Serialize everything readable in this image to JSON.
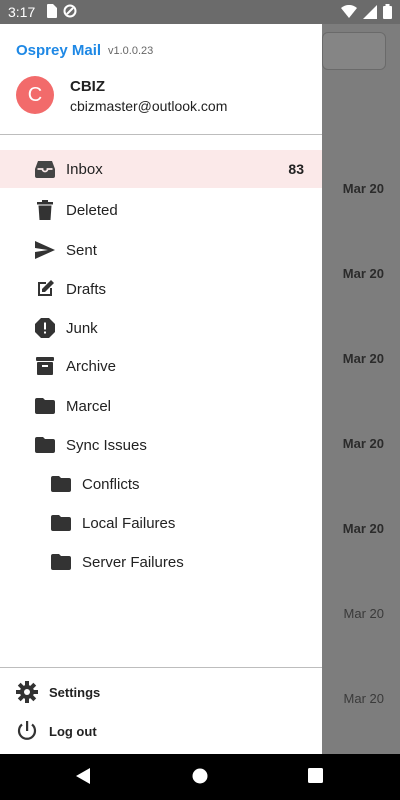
{
  "status_bar": {
    "time": "3:17"
  },
  "app": {
    "name": "Osprey Mail",
    "version": "v1.0.0.23"
  },
  "account": {
    "initial": "C",
    "name": "CBIZ",
    "email": "cbizmaster@outlook.com"
  },
  "folders": [
    {
      "label": "Inbox",
      "count": "83",
      "icon": "inbox-icon"
    },
    {
      "label": "Deleted",
      "icon": "trash-icon"
    },
    {
      "label": "Sent",
      "icon": "send-icon"
    },
    {
      "label": "Drafts",
      "icon": "edit-icon"
    },
    {
      "label": "Junk",
      "icon": "spam-icon"
    },
    {
      "label": "Archive",
      "icon": "archive-icon"
    },
    {
      "label": "Marcel",
      "icon": "folder-icon"
    },
    {
      "label": "Sync Issues",
      "icon": "folder-icon"
    },
    {
      "label": "Conflicts",
      "icon": "folder-icon"
    },
    {
      "label": "Local Failures",
      "icon": "folder-icon"
    },
    {
      "label": "Server Failures",
      "icon": "folder-icon"
    }
  ],
  "bottom_menu": {
    "settings": "Settings",
    "logout": "Log out"
  },
  "background_list": {
    "dates": [
      "Mar 20",
      "Mar 20",
      "Mar 20",
      "Mar 20",
      "Mar 20",
      "Mar 20",
      "Mar 20"
    ]
  },
  "colors": {
    "accent": "#1e88e5",
    "avatar": "#f26b6b",
    "selected_bg": "#fbe9e9"
  }
}
